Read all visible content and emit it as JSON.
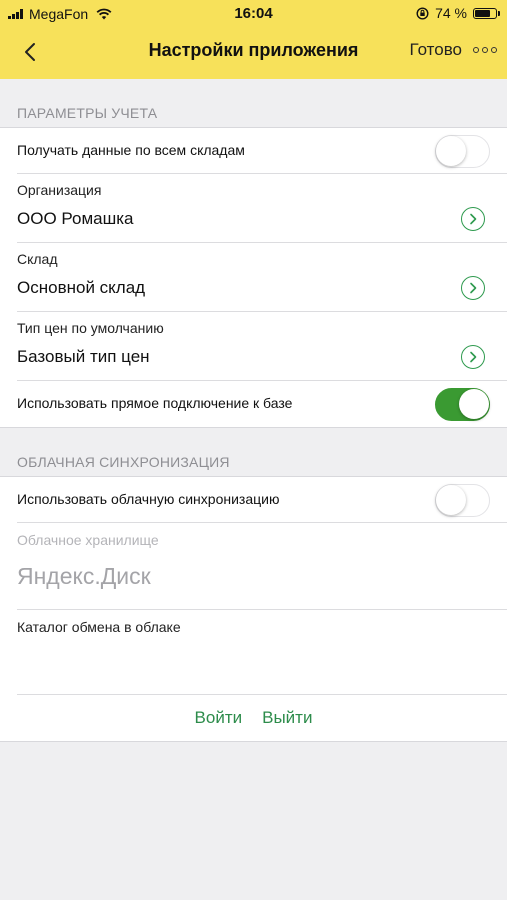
{
  "status_bar": {
    "carrier": "MegaFon",
    "time": "16:04",
    "battery": "74 %",
    "battery_level": 0.74
  },
  "nav": {
    "title": "Настройки приложения",
    "done_label": "Готово"
  },
  "accounting": {
    "header": "ПАРАМЕТРЫ УЧЕТА",
    "all_warehouses_label": "Получать данные по всем складам",
    "all_warehouses_on": false,
    "organization_caption": "Организация",
    "organization_value": "ООО Ромашка",
    "warehouse_caption": "Склад",
    "warehouse_value": "Основной склад",
    "price_type_caption": "Тип цен по умолчанию",
    "price_type_value": "Базовый тип цен",
    "direct_connection_label": "Использовать прямое подключение к базе",
    "direct_connection_on": true
  },
  "cloud": {
    "header": "ОБЛАЧНАЯ СИНХРОНИЗАЦИЯ",
    "use_cloud_label": "Использовать облачную синхронизацию",
    "use_cloud_on": false,
    "storage_caption": "Облачное хранилище",
    "storage_value": "Яндекс.Диск",
    "catalog_caption": "Каталог обмена в облаке",
    "catalog_value": "",
    "login_label": "Войти",
    "logout_label": "Выйти"
  },
  "colors": {
    "header_bg": "#f7e15a",
    "accent_green": "#2d8c4b",
    "toggle_on": "#3a9a32",
    "background": "#efeff1"
  }
}
